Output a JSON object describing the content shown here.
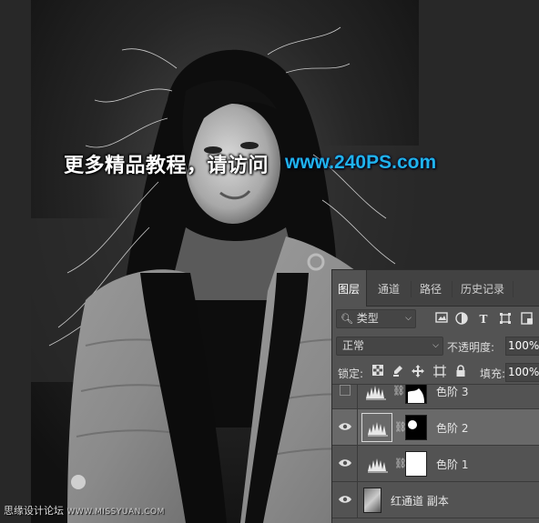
{
  "promo": {
    "text": "更多精品教程，请访问",
    "url": "www.240PS.com"
  },
  "site_mark": {
    "name": "思缘设计论坛",
    "url": "WWW.MISSYUAN.COM"
  },
  "layers_panel": {
    "tabs": [
      {
        "label": "图层",
        "active": true
      },
      {
        "label": "通道",
        "active": false
      },
      {
        "label": "路径",
        "active": false
      },
      {
        "label": "历史记录",
        "active": false
      }
    ],
    "filter_kind": "类型",
    "filter_icons": [
      "image-filter-icon",
      "adjustment-filter-icon",
      "type-filter-icon",
      "shape-filter-icon",
      "smart-object-filter-icon"
    ],
    "blend_mode": "正常",
    "opacity_label": "不透明度:",
    "opacity_value": "100%",
    "lock_label": "锁定:",
    "lock_icons": [
      "lock-transparent-icon",
      "lock-paint-icon",
      "lock-position-icon",
      "lock-artboard-icon",
      "lock-all-icon"
    ],
    "fill_label": "填充:",
    "fill_value": "100%",
    "layers": [
      {
        "name": "色阶 3",
        "visible": false,
        "type": "levels"
      },
      {
        "name": "色阶 2",
        "visible": true,
        "type": "levels",
        "selected": true
      },
      {
        "name": "色阶 1",
        "visible": true,
        "type": "levels"
      },
      {
        "name": "红通道 副本",
        "visible": true,
        "type": "image"
      }
    ]
  },
  "colors": {
    "panel_bg": "#535353",
    "tab_bar_bg": "#424242",
    "selected_row": "#696969",
    "url_blue": "#1fb3ec"
  }
}
